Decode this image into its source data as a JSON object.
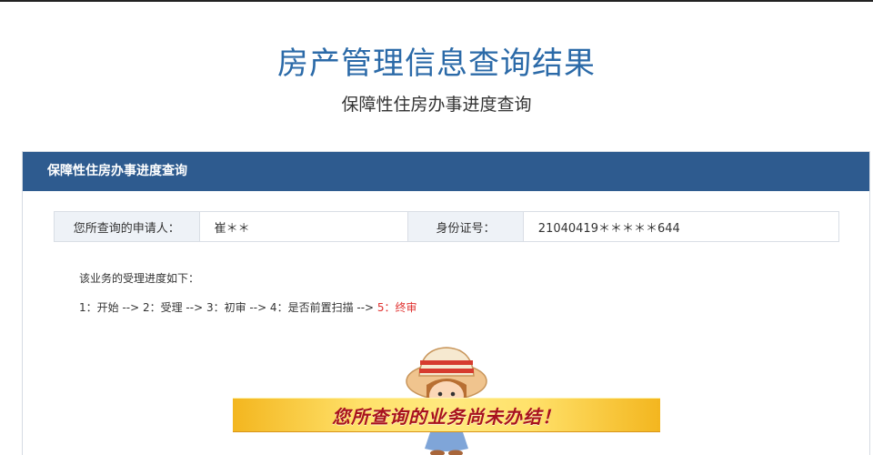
{
  "header": {
    "title": "房产管理信息查询结果",
    "subtitle": "保障性住房办事进度查询"
  },
  "panel": {
    "title": "保障性住房办事进度查询",
    "applicant_label": "您所查询的申请人：",
    "applicant_value": "崔＊＊",
    "id_label": "身份证号：",
    "id_value": "21040419＊＊＊＊＊644"
  },
  "progress": {
    "intro": "该业务的受理进度如下：",
    "steps_before_current": "1：开始 --> 2：受理 --> 3：初审 --> 4：是否前置扫描 --> ",
    "current_step": "5：终审",
    "current_color": "#e0312f"
  },
  "notice": {
    "message": "您所查询的业务尚未办结！"
  },
  "colors": {
    "title_blue": "#2b6aa8",
    "header_bar": "#2e5b8f",
    "banner_gold": "#f6c634",
    "banner_text": "#a8121e"
  }
}
